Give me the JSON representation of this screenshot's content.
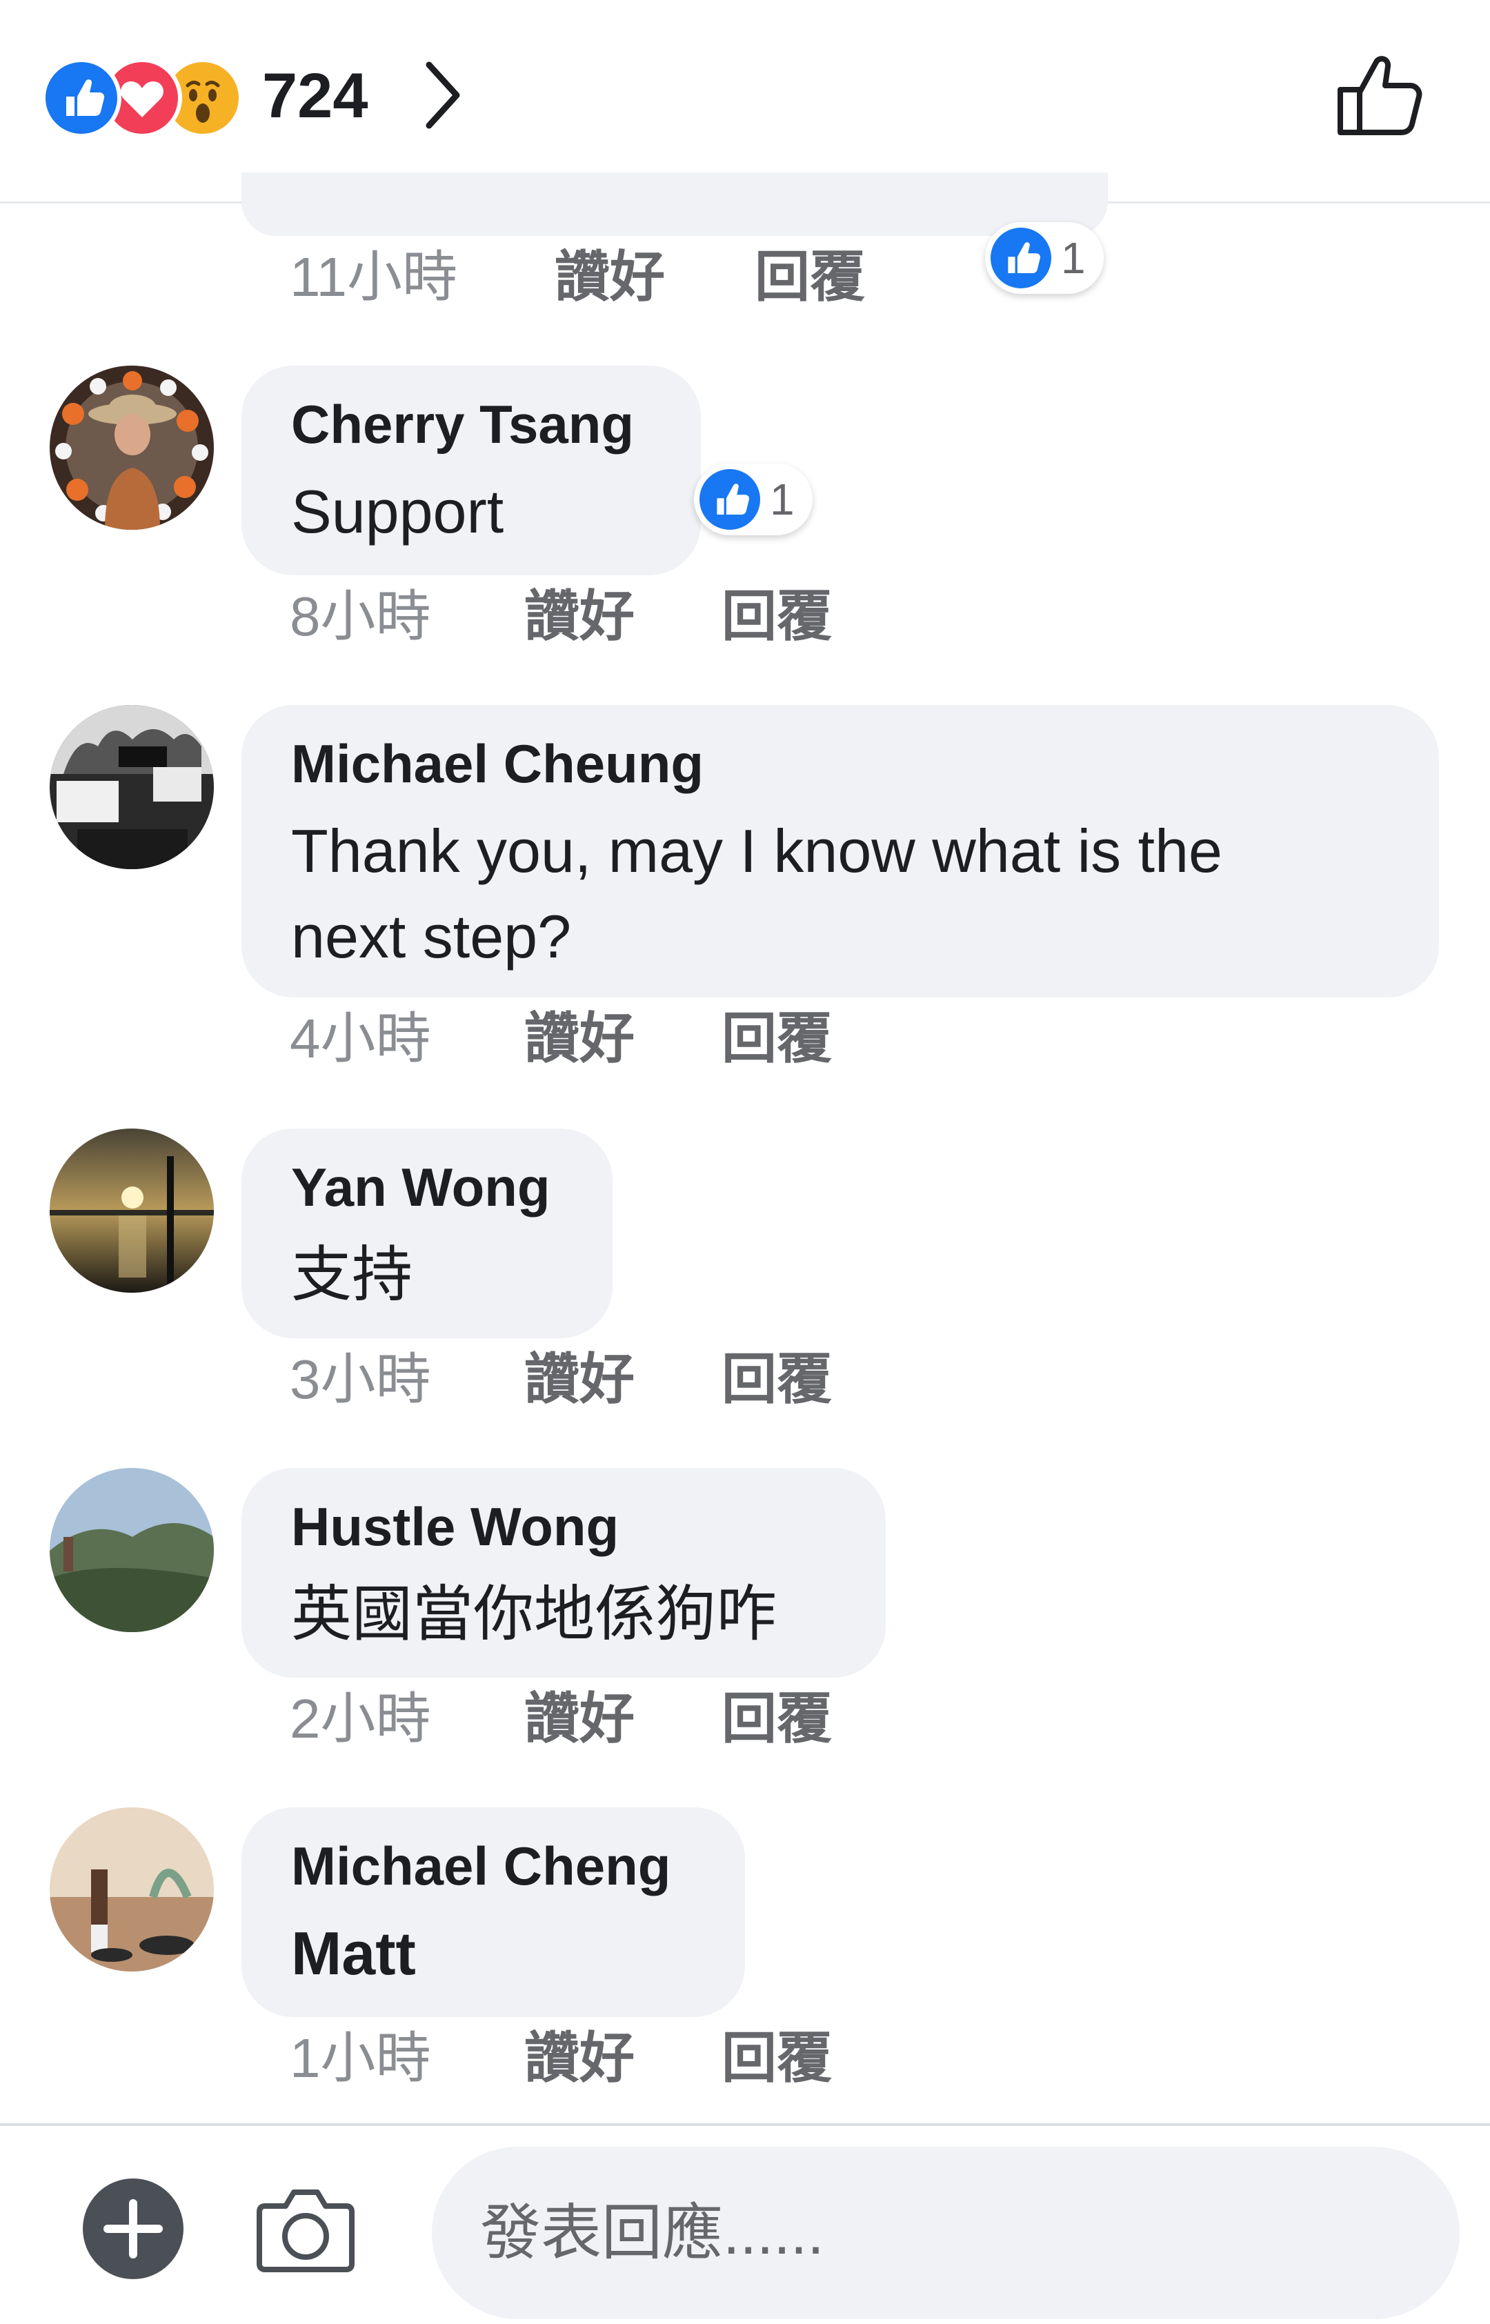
{
  "header": {
    "reactions": [
      "like",
      "love",
      "wow"
    ],
    "reaction_count": "724",
    "chevron_icon": "chevron-right-icon",
    "like_button_icon": "thumbs-up-outline-icon"
  },
  "colors": {
    "like_blue": "#1877f2",
    "love_red": "#f33e58",
    "wow_yellow": "#f7b125",
    "bubble_bg": "#f0f2f5",
    "meta_grey": "#65676b"
  },
  "actions": {
    "like": "讚好",
    "reply": "回覆"
  },
  "partial_comment": {
    "time": "11小時",
    "likes": "1"
  },
  "comments": [
    {
      "name": "Cherry Tsang",
      "text_lines": [
        "Support"
      ],
      "time": "8小時",
      "likes": "1"
    },
    {
      "name": "Michael Cheung",
      "text_lines": [
        "Thank you, may I know what is the",
        "next step?"
      ],
      "time": "4小時"
    },
    {
      "name": "Yan Wong",
      "text_lines": [
        "支持"
      ],
      "time": "3小時"
    },
    {
      "name": "Hustle Wong",
      "text_lines": [
        "英國當你地係狗咋"
      ],
      "time": "2小時"
    },
    {
      "name": "Michael Cheng",
      "text_lines": [
        "Matt"
      ],
      "time": "1小時",
      "text_bold": true
    }
  ],
  "composer": {
    "placeholder": "發表回應......",
    "add_icon": "plus-circle-icon",
    "camera_icon": "camera-icon"
  }
}
